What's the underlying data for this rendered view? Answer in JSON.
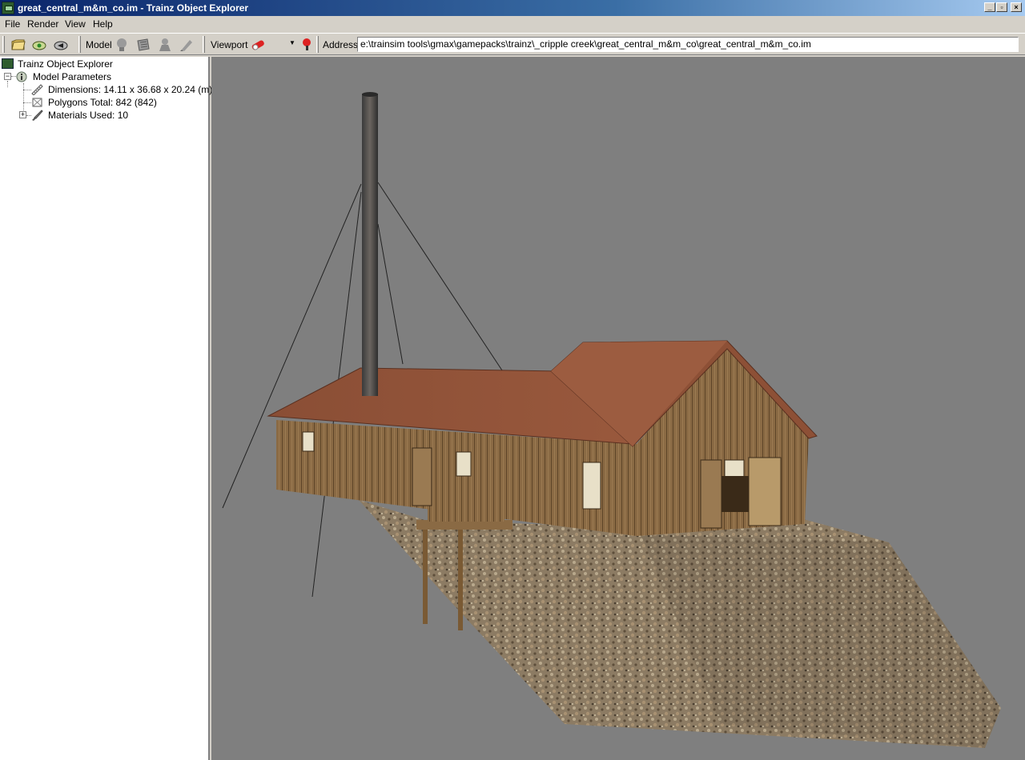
{
  "window": {
    "title": "great_central_m&m_co.im - Trainz Object Explorer"
  },
  "menu": {
    "file": "File",
    "render": "Render",
    "view": "View",
    "help": "Help"
  },
  "toolbar": {
    "model_label": "Model",
    "viewport_label": "Viewport",
    "address_label": "Address",
    "address_value": "e:\\trainsim tools\\gmax\\gamepacks\\trainz\\_cripple creek\\great_central_m&m_co\\great_central_m&m_co.im"
  },
  "tree": {
    "root": "Trainz Object Explorer",
    "model_parameters": "Model Parameters",
    "dimensions": "Dimensions: 14.11 x 36.68 x 20.24 (m)",
    "polygons": "Polygons Total: 842 (842)",
    "materials": "Materials Used: 10"
  },
  "icons": {
    "open": "open-folder-icon",
    "reload": "reload-icon",
    "export": "export-icon",
    "render_viewport": "viewport-render-icon",
    "light": "light-icon"
  },
  "colors": {
    "titlebar_start": "#0a246a",
    "viewport_bg": "#7f7f7f"
  }
}
